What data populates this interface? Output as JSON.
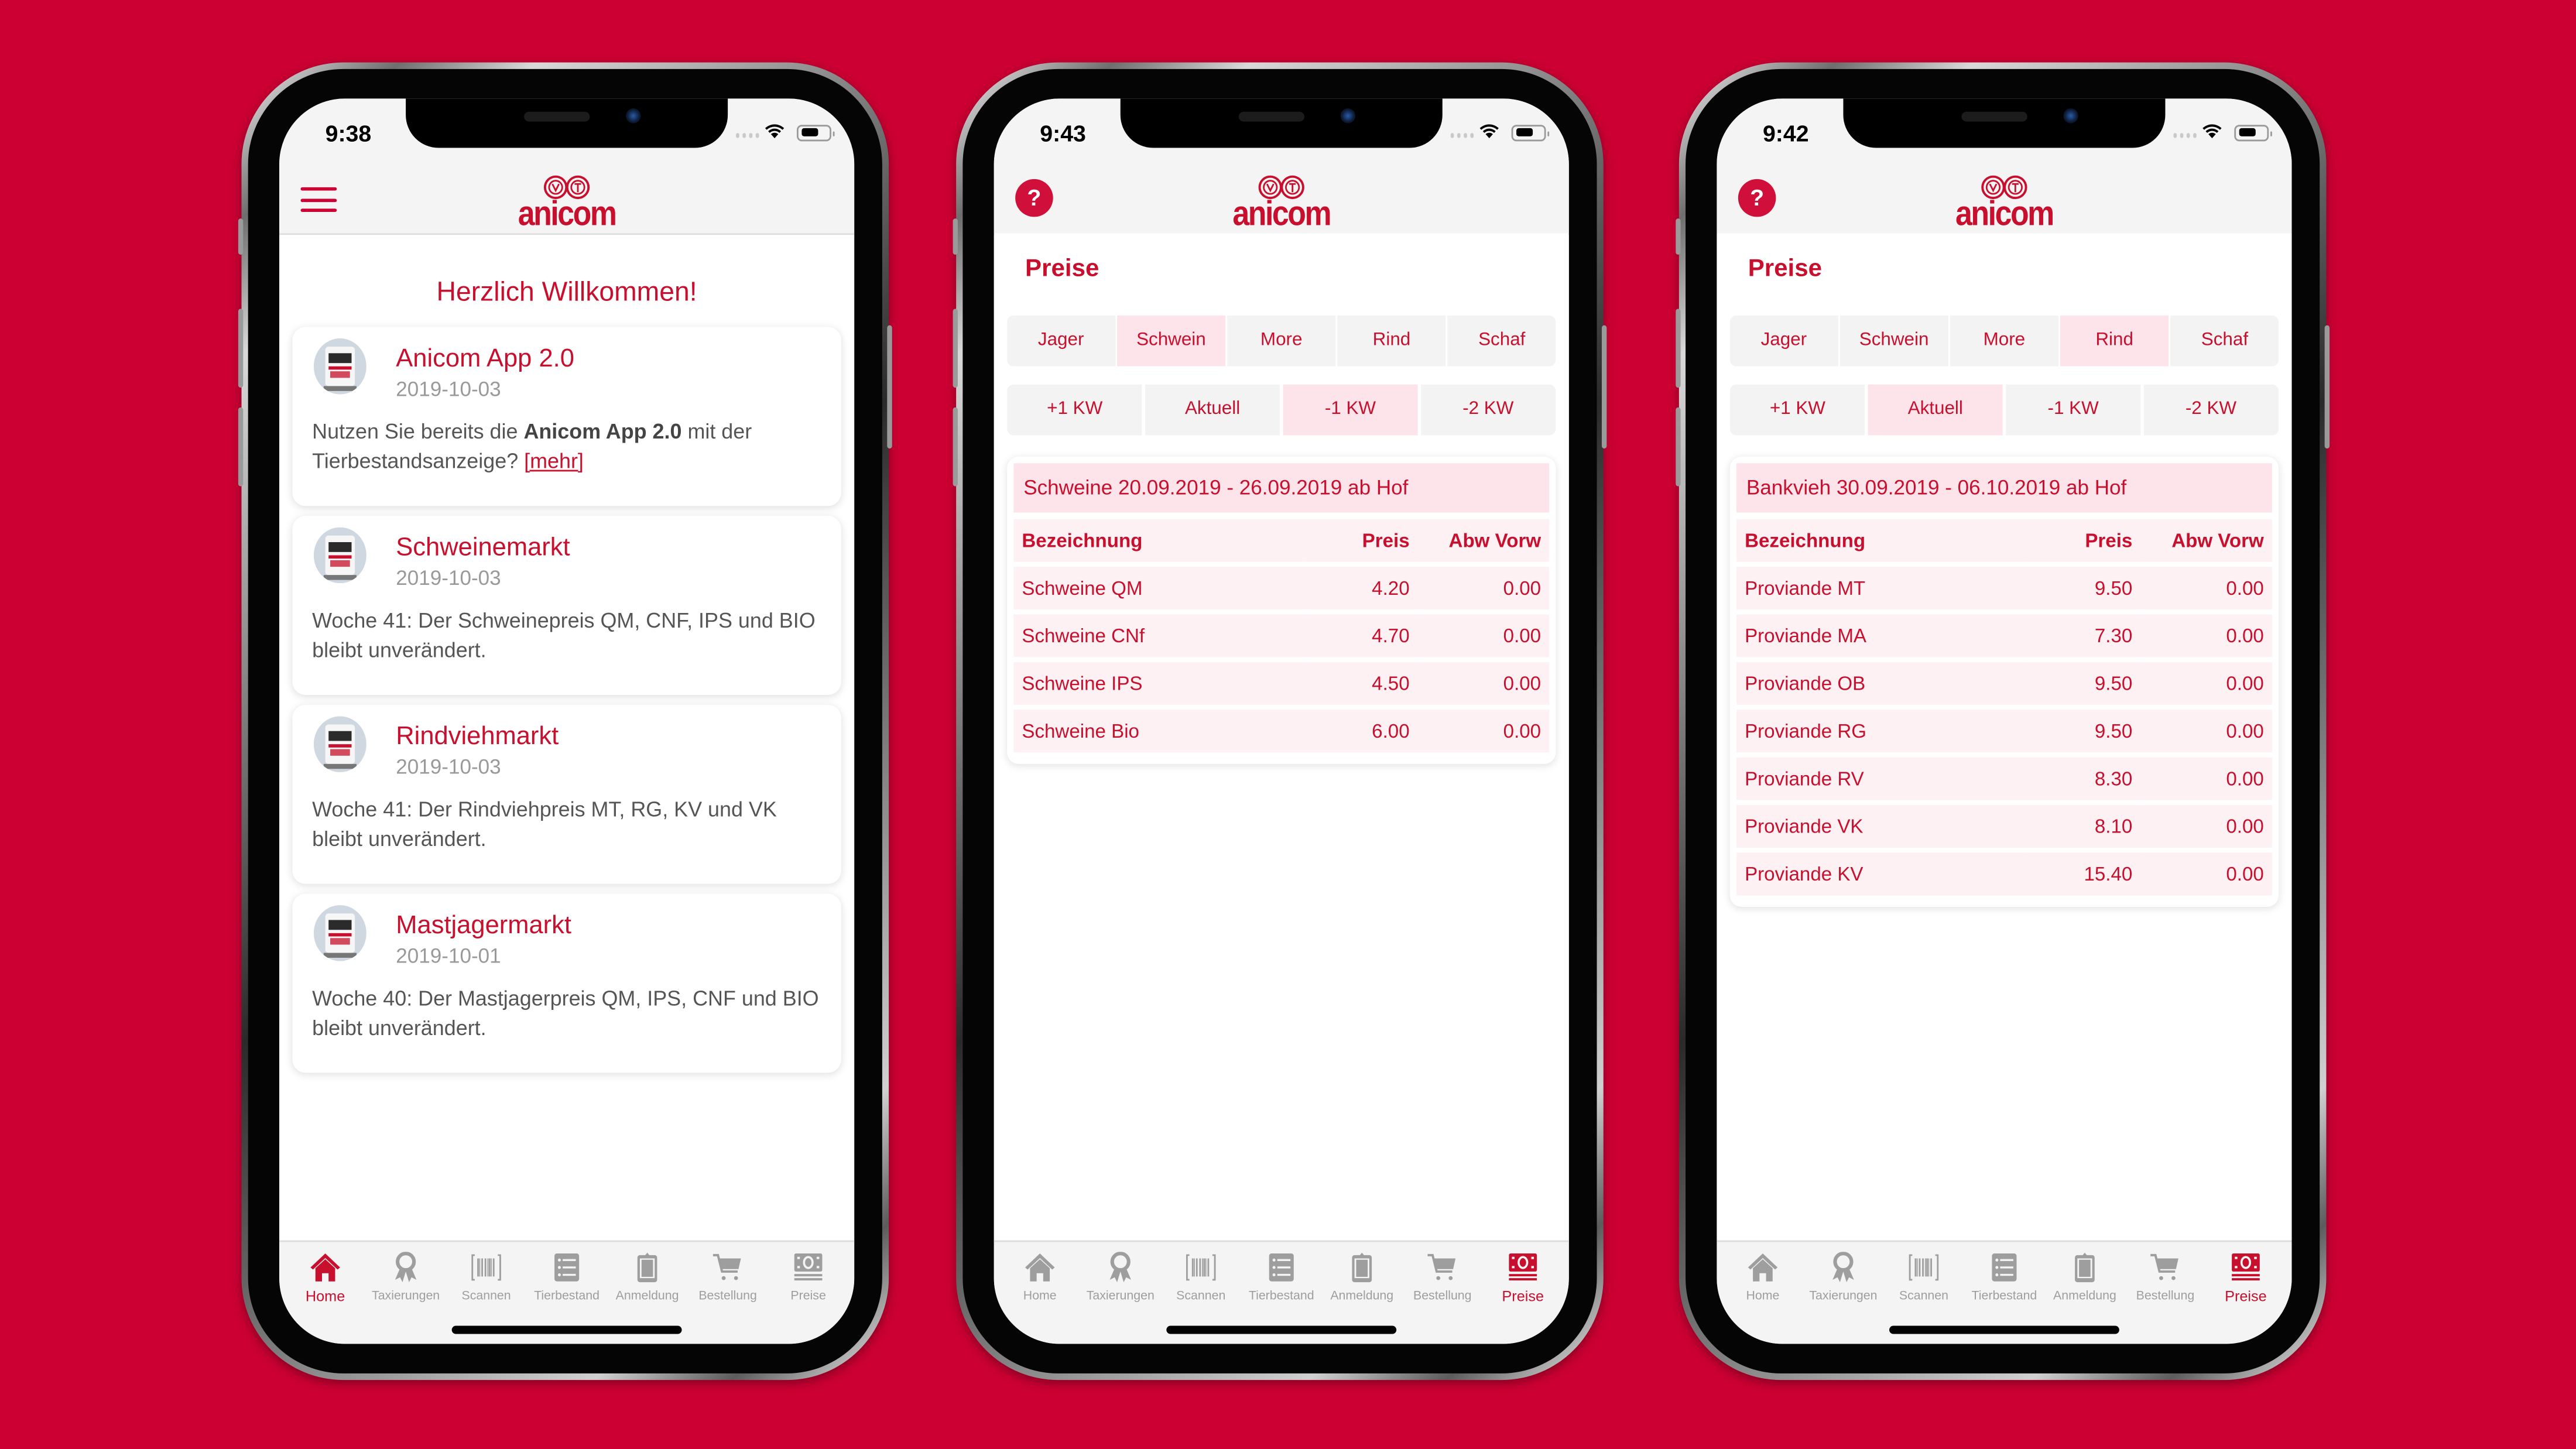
{
  "background_color": "#cc0033",
  "accent_color": "#c8102e",
  "app_name": "anicom",
  "tab_bar": [
    {
      "label": "Home",
      "icon": "home-icon"
    },
    {
      "label": "Taxierungen",
      "icon": "award-ribbon-icon"
    },
    {
      "label": "Scannen",
      "icon": "barcode-icon"
    },
    {
      "label": "Tierbestand",
      "icon": "list-icon"
    },
    {
      "label": "Anmeldung",
      "icon": "clipboard-icon"
    },
    {
      "label": "Bestellung",
      "icon": "cart-icon"
    },
    {
      "label": "Preise",
      "icon": "money-icon"
    }
  ],
  "phones": [
    {
      "status_time": "9:38",
      "header_left_icon": "hamburger-menu-icon",
      "active_tab": "Home",
      "welcome": "Herzlich Willkommen!",
      "news": [
        {
          "title": "Anicom App 2.0",
          "date": "2019-10-03",
          "body_pre": "Nutzen Sie bereits die ",
          "body_bold": "Anicom App 2.0",
          "body_post": " mit der Tierbestandsanzeige? ",
          "link": "[mehr]"
        },
        {
          "title": "Schweinemarkt",
          "date": "2019-10-03",
          "body": "Woche 41: Der Schweinepreis QM, CNF, IPS und BIO bleibt unverändert."
        },
        {
          "title": "Rindviehmarkt",
          "date": "2019-10-03",
          "body": "Woche 41: Der Rindviehpreis MT, RG, KV und VK bleibt unverändert."
        },
        {
          "title": "Mastjagermarkt",
          "date": "2019-10-01",
          "body": "Woche 40: Der Mastjagerpreis QM, IPS, CNF und BIO bleibt unverändert."
        }
      ]
    },
    {
      "status_time": "9:43",
      "header_left_icon": "help-icon",
      "help_label": "?",
      "active_tab": "Preise",
      "page_title": "Preise",
      "categories": [
        "Jager",
        "Schwein",
        "More",
        "Rind",
        "Schaf"
      ],
      "active_category": "Schwein",
      "weeks": [
        "+1 KW",
        "Aktuell",
        "-1 KW",
        "-2 KW"
      ],
      "active_week": "-1 KW",
      "table_title": "Schweine 20.09.2019 - 26.09.2019 ab Hof",
      "columns": [
        "Bezeichnung",
        "Preis",
        "Abw Vorw"
      ],
      "rows": [
        {
          "name": "Schweine QM",
          "preis": "4.20",
          "abw": "0.00"
        },
        {
          "name": "Schweine CNf",
          "preis": "4.70",
          "abw": "0.00"
        },
        {
          "name": "Schweine IPS",
          "preis": "4.50",
          "abw": "0.00"
        },
        {
          "name": "Schweine Bio",
          "preis": "6.00",
          "abw": "0.00"
        }
      ]
    },
    {
      "status_time": "9:42",
      "header_left_icon": "help-icon",
      "help_label": "?",
      "active_tab": "Preise",
      "page_title": "Preise",
      "categories": [
        "Jager",
        "Schwein",
        "More",
        "Rind",
        "Schaf"
      ],
      "active_category": "Rind",
      "weeks": [
        "+1 KW",
        "Aktuell",
        "-1 KW",
        "-2 KW"
      ],
      "active_week": "Aktuell",
      "table_title": "Bankvieh 30.09.2019 - 06.10.2019 ab Hof",
      "columns": [
        "Bezeichnung",
        "Preis",
        "Abw Vorw"
      ],
      "rows": [
        {
          "name": "Proviande MT",
          "preis": "9.50",
          "abw": "0.00"
        },
        {
          "name": "Proviande MA",
          "preis": "7.30",
          "abw": "0.00"
        },
        {
          "name": "Proviande OB",
          "preis": "9.50",
          "abw": "0.00"
        },
        {
          "name": "Proviande RG",
          "preis": "9.50",
          "abw": "0.00"
        },
        {
          "name": "Proviande RV",
          "preis": "8.30",
          "abw": "0.00"
        },
        {
          "name": "Proviande VK",
          "preis": "8.10",
          "abw": "0.00"
        },
        {
          "name": "Proviande KV",
          "preis": "15.40",
          "abw": "0.00"
        }
      ]
    }
  ]
}
